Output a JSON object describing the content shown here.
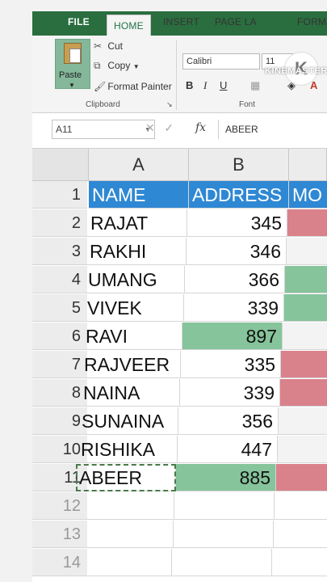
{
  "ribbon": {
    "tabs": {
      "file": "FILE",
      "home": "HOME",
      "insert": "INSERT",
      "page_layout": "PAGE LA",
      "formulas": "FORM"
    },
    "clipboard": {
      "paste": "Paste",
      "cut": "Cut",
      "copy": "Copy",
      "format_painter": "Format Painter",
      "group_label": "Clipboard"
    },
    "font": {
      "name": "Calibri",
      "size": "11",
      "bold": "B",
      "italic": "I",
      "underline": "U",
      "group_label": "Font"
    },
    "watermark": "KINEMASTER"
  },
  "formula_bar": {
    "name_box": "A11",
    "value": "ABEER",
    "fx": "fx"
  },
  "grid": {
    "columns": [
      "A",
      "B"
    ],
    "header_row": {
      "name": "NAME",
      "address": "ADDRESS",
      "c": "MO"
    },
    "row_numbers": [
      "1",
      "2",
      "3",
      "4",
      "5",
      "6",
      "7",
      "8",
      "9",
      "10",
      "11",
      "12",
      "13",
      "14"
    ],
    "rows": [
      {
        "name": "RAJAT",
        "address": "345",
        "fill": "#d9828c"
      },
      {
        "name": "RAKHI",
        "address": "346",
        "fill": "#f3f3f3"
      },
      {
        "name": "UMANG",
        "address": "366",
        "fill": "#86c49b"
      },
      {
        "name": "VIVEK",
        "address": "339",
        "fill": "#86c49b"
      },
      {
        "name": "RAVI",
        "address": "897",
        "fill": "#f3f3f3"
      },
      {
        "name": "RAJVEER",
        "address": "335",
        "fill": "#d9828c"
      },
      {
        "name": "NAINA",
        "address": "339",
        "fill": "#d9828c"
      },
      {
        "name": "SUNAINA",
        "address": "356",
        "fill": "#f3f3f3"
      },
      {
        "name": "RISHIKA",
        "address": "447",
        "fill": "#f3f3f3"
      },
      {
        "name": "ABEER",
        "address": "885",
        "fill": "#d9828c"
      }
    ],
    "colors": {
      "header_blue": "#2f88d3",
      "green_fill": "#86c49b"
    }
  }
}
